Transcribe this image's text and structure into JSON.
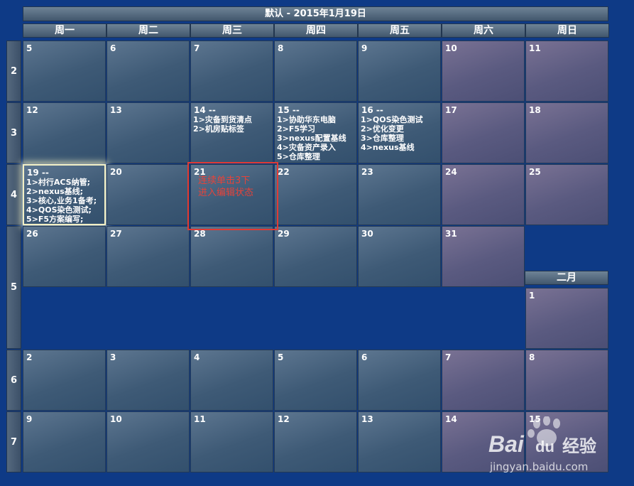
{
  "calendar": {
    "title": "默认 - 2015年1月19日",
    "day_headers": [
      "周一",
      "周二",
      "周三",
      "周四",
      "周五",
      "周六",
      "周日"
    ],
    "week_numbers": [
      "2",
      "3",
      "4",
      "5",
      "6",
      "7"
    ],
    "next_month_label": "二月",
    "days": [
      {
        "day": "5",
        "notes": []
      },
      {
        "day": "6",
        "notes": []
      },
      {
        "day": "7",
        "notes": []
      },
      {
        "day": "8",
        "notes": []
      },
      {
        "day": "9",
        "notes": []
      },
      {
        "day": "10",
        "notes": []
      },
      {
        "day": "11",
        "notes": []
      },
      {
        "day": "12",
        "notes": []
      },
      {
        "day": "13",
        "notes": []
      },
      {
        "day": "14 --",
        "notes": [
          "1>灾备到货清点",
          "2>机房贴标签"
        ]
      },
      {
        "day": "15 --",
        "notes": [
          "1>协助华东电脑",
          "2>F5学习",
          "3>nexus配置基线",
          "4>灾备资产录入",
          "5>仓库整理"
        ]
      },
      {
        "day": "16 --",
        "notes": [
          "1>QOS染色测试",
          "2>优化变更",
          "3>仓库整理",
          "4>nexus基线"
        ]
      },
      {
        "day": "17",
        "notes": []
      },
      {
        "day": "18",
        "notes": []
      },
      {
        "day": "19 --",
        "notes": [
          "1>村行ACS纳管;",
          "2>nexus基线;",
          "3>核心,业务1备考;",
          "4>QOS染色测试;",
          "5>F5方案编写;"
        ]
      },
      {
        "day": "20",
        "notes": []
      },
      {
        "day": "21",
        "notes": []
      },
      {
        "day": "22",
        "notes": []
      },
      {
        "day": "23",
        "notes": []
      },
      {
        "day": "24",
        "notes": []
      },
      {
        "day": "25",
        "notes": []
      },
      {
        "day": "26",
        "notes": []
      },
      {
        "day": "27",
        "notes": []
      },
      {
        "day": "28",
        "notes": []
      },
      {
        "day": "29",
        "notes": []
      },
      {
        "day": "30",
        "notes": []
      },
      {
        "day": "31",
        "notes": []
      },
      {
        "day": "1",
        "notes": []
      },
      {
        "day": "2",
        "notes": []
      },
      {
        "day": "3",
        "notes": []
      },
      {
        "day": "4",
        "notes": []
      },
      {
        "day": "5",
        "notes": []
      },
      {
        "day": "6",
        "notes": []
      },
      {
        "day": "7",
        "notes": []
      },
      {
        "day": "8",
        "notes": []
      },
      {
        "day": "9",
        "notes": []
      },
      {
        "day": "10",
        "notes": []
      },
      {
        "day": "11",
        "notes": []
      },
      {
        "day": "12",
        "notes": []
      },
      {
        "day": "13",
        "notes": []
      },
      {
        "day": "14",
        "notes": []
      },
      {
        "day": "15",
        "notes": []
      }
    ]
  },
  "annotation": {
    "text": "连续单击3下\n进入编辑状态",
    "color": "#e03a34"
  },
  "watermark": {
    "brand_bai": "Bai",
    "brand_du": "du",
    "brand_cn": "经验",
    "url": "jingyan.baidu.com"
  },
  "colors": {
    "background": "#0e3a86",
    "weekday_cell": "#4a6580",
    "weekend_cell": "#6a6690",
    "today_glow": "#f2efc4"
  }
}
